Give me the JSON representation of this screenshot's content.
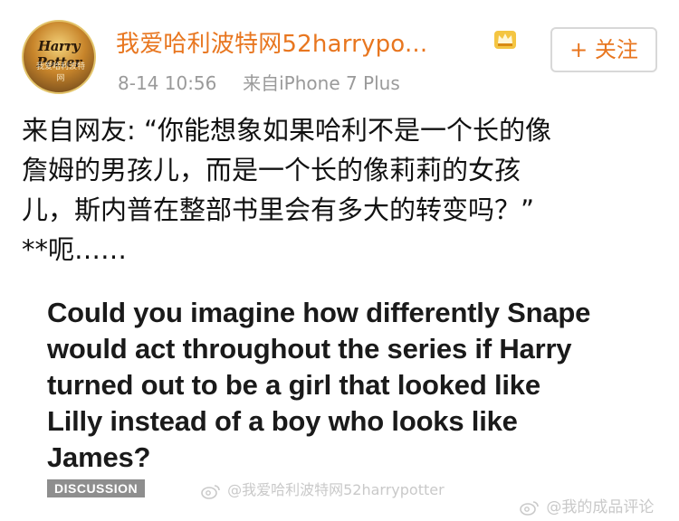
{
  "header": {
    "avatar_text": "Harry Potter",
    "avatar_subtext": "我爱哈利波特网",
    "username": "我爱哈利波特网52harrypo...",
    "timestamp": "8-14 10:56",
    "source": "来自iPhone 7 Plus",
    "follow_label": "+ 关注"
  },
  "post": {
    "lines": [
      "来自网友: “你能想象如果哈利不是一个长的像",
      "詹姆的男孩儿，而是一个长的像莉莉的女孩",
      "儿，斯内普在整部书里会有多大的转变吗？”",
      "**呃……"
    ]
  },
  "meme": {
    "lines": [
      "Could you imagine how differently Snape",
      "would act throughout the series if Harry",
      "turned out to be a girl that looked like",
      "Lilly instead of a boy who looks like",
      "James?"
    ],
    "tag": "DISCUSSION"
  },
  "watermarks": {
    "center": "@我爱哈利波特网52harrypotter",
    "corner": "@我的成品评论"
  },
  "colors": {
    "username": "#e8761f",
    "meta": "#9a9a9a",
    "crown": "#e2a92a"
  },
  "icons": {
    "crown": "vip-crown-icon",
    "weibo": "weibo-icon"
  }
}
